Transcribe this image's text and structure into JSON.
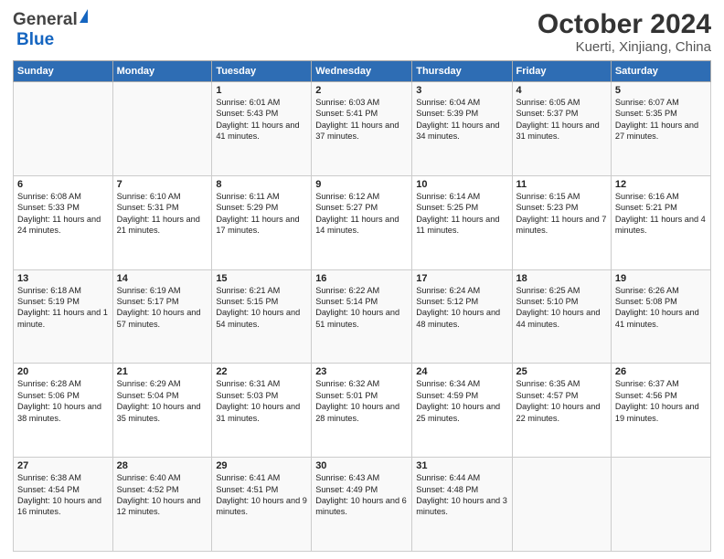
{
  "header": {
    "logo_line1": "General",
    "logo_line2": "Blue",
    "title": "October 2024",
    "subtitle": "Kuerti, Xinjiang, China"
  },
  "days_of_week": [
    "Sunday",
    "Monday",
    "Tuesday",
    "Wednesday",
    "Thursday",
    "Friday",
    "Saturday"
  ],
  "weeks": [
    [
      {
        "day": "",
        "sunrise": "",
        "sunset": "",
        "daylight": ""
      },
      {
        "day": "",
        "sunrise": "",
        "sunset": "",
        "daylight": ""
      },
      {
        "day": "1",
        "sunrise": "Sunrise: 6:01 AM",
        "sunset": "Sunset: 5:43 PM",
        "daylight": "Daylight: 11 hours and 41 minutes."
      },
      {
        "day": "2",
        "sunrise": "Sunrise: 6:03 AM",
        "sunset": "Sunset: 5:41 PM",
        "daylight": "Daylight: 11 hours and 37 minutes."
      },
      {
        "day": "3",
        "sunrise": "Sunrise: 6:04 AM",
        "sunset": "Sunset: 5:39 PM",
        "daylight": "Daylight: 11 hours and 34 minutes."
      },
      {
        "day": "4",
        "sunrise": "Sunrise: 6:05 AM",
        "sunset": "Sunset: 5:37 PM",
        "daylight": "Daylight: 11 hours and 31 minutes."
      },
      {
        "day": "5",
        "sunrise": "Sunrise: 6:07 AM",
        "sunset": "Sunset: 5:35 PM",
        "daylight": "Daylight: 11 hours and 27 minutes."
      }
    ],
    [
      {
        "day": "6",
        "sunrise": "Sunrise: 6:08 AM",
        "sunset": "Sunset: 5:33 PM",
        "daylight": "Daylight: 11 hours and 24 minutes."
      },
      {
        "day": "7",
        "sunrise": "Sunrise: 6:10 AM",
        "sunset": "Sunset: 5:31 PM",
        "daylight": "Daylight: 11 hours and 21 minutes."
      },
      {
        "day": "8",
        "sunrise": "Sunrise: 6:11 AM",
        "sunset": "Sunset: 5:29 PM",
        "daylight": "Daylight: 11 hours and 17 minutes."
      },
      {
        "day": "9",
        "sunrise": "Sunrise: 6:12 AM",
        "sunset": "Sunset: 5:27 PM",
        "daylight": "Daylight: 11 hours and 14 minutes."
      },
      {
        "day": "10",
        "sunrise": "Sunrise: 6:14 AM",
        "sunset": "Sunset: 5:25 PM",
        "daylight": "Daylight: 11 hours and 11 minutes."
      },
      {
        "day": "11",
        "sunrise": "Sunrise: 6:15 AM",
        "sunset": "Sunset: 5:23 PM",
        "daylight": "Daylight: 11 hours and 7 minutes."
      },
      {
        "day": "12",
        "sunrise": "Sunrise: 6:16 AM",
        "sunset": "Sunset: 5:21 PM",
        "daylight": "Daylight: 11 hours and 4 minutes."
      }
    ],
    [
      {
        "day": "13",
        "sunrise": "Sunrise: 6:18 AM",
        "sunset": "Sunset: 5:19 PM",
        "daylight": "Daylight: 11 hours and 1 minute."
      },
      {
        "day": "14",
        "sunrise": "Sunrise: 6:19 AM",
        "sunset": "Sunset: 5:17 PM",
        "daylight": "Daylight: 10 hours and 57 minutes."
      },
      {
        "day": "15",
        "sunrise": "Sunrise: 6:21 AM",
        "sunset": "Sunset: 5:15 PM",
        "daylight": "Daylight: 10 hours and 54 minutes."
      },
      {
        "day": "16",
        "sunrise": "Sunrise: 6:22 AM",
        "sunset": "Sunset: 5:14 PM",
        "daylight": "Daylight: 10 hours and 51 minutes."
      },
      {
        "day": "17",
        "sunrise": "Sunrise: 6:24 AM",
        "sunset": "Sunset: 5:12 PM",
        "daylight": "Daylight: 10 hours and 48 minutes."
      },
      {
        "day": "18",
        "sunrise": "Sunrise: 6:25 AM",
        "sunset": "Sunset: 5:10 PM",
        "daylight": "Daylight: 10 hours and 44 minutes."
      },
      {
        "day": "19",
        "sunrise": "Sunrise: 6:26 AM",
        "sunset": "Sunset: 5:08 PM",
        "daylight": "Daylight: 10 hours and 41 minutes."
      }
    ],
    [
      {
        "day": "20",
        "sunrise": "Sunrise: 6:28 AM",
        "sunset": "Sunset: 5:06 PM",
        "daylight": "Daylight: 10 hours and 38 minutes."
      },
      {
        "day": "21",
        "sunrise": "Sunrise: 6:29 AM",
        "sunset": "Sunset: 5:04 PM",
        "daylight": "Daylight: 10 hours and 35 minutes."
      },
      {
        "day": "22",
        "sunrise": "Sunrise: 6:31 AM",
        "sunset": "Sunset: 5:03 PM",
        "daylight": "Daylight: 10 hours and 31 minutes."
      },
      {
        "day": "23",
        "sunrise": "Sunrise: 6:32 AM",
        "sunset": "Sunset: 5:01 PM",
        "daylight": "Daylight: 10 hours and 28 minutes."
      },
      {
        "day": "24",
        "sunrise": "Sunrise: 6:34 AM",
        "sunset": "Sunset: 4:59 PM",
        "daylight": "Daylight: 10 hours and 25 minutes."
      },
      {
        "day": "25",
        "sunrise": "Sunrise: 6:35 AM",
        "sunset": "Sunset: 4:57 PM",
        "daylight": "Daylight: 10 hours and 22 minutes."
      },
      {
        "day": "26",
        "sunrise": "Sunrise: 6:37 AM",
        "sunset": "Sunset: 4:56 PM",
        "daylight": "Daylight: 10 hours and 19 minutes."
      }
    ],
    [
      {
        "day": "27",
        "sunrise": "Sunrise: 6:38 AM",
        "sunset": "Sunset: 4:54 PM",
        "daylight": "Daylight: 10 hours and 16 minutes."
      },
      {
        "day": "28",
        "sunrise": "Sunrise: 6:40 AM",
        "sunset": "Sunset: 4:52 PM",
        "daylight": "Daylight: 10 hours and 12 minutes."
      },
      {
        "day": "29",
        "sunrise": "Sunrise: 6:41 AM",
        "sunset": "Sunset: 4:51 PM",
        "daylight": "Daylight: 10 hours and 9 minutes."
      },
      {
        "day": "30",
        "sunrise": "Sunrise: 6:43 AM",
        "sunset": "Sunset: 4:49 PM",
        "daylight": "Daylight: 10 hours and 6 minutes."
      },
      {
        "day": "31",
        "sunrise": "Sunrise: 6:44 AM",
        "sunset": "Sunset: 4:48 PM",
        "daylight": "Daylight: 10 hours and 3 minutes."
      },
      {
        "day": "",
        "sunrise": "",
        "sunset": "",
        "daylight": ""
      },
      {
        "day": "",
        "sunrise": "",
        "sunset": "",
        "daylight": ""
      }
    ]
  ]
}
